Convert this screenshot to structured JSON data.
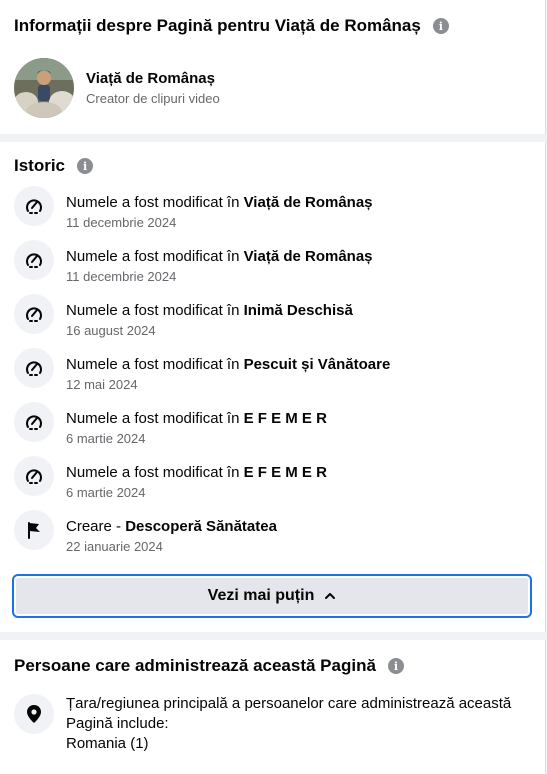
{
  "info": {
    "title": "Informații despre Pagină pentru Viață de Românaș",
    "page_name": "Viață de Românaș",
    "page_category": "Creator de clipuri video"
  },
  "history": {
    "title": "Istoric",
    "items": [
      {
        "prefix": "Numele a fost modificat în ",
        "name": "Viață de Românaș",
        "date": "11 decembrie 2024",
        "icon": "rename-icon"
      },
      {
        "prefix": "Numele a fost modificat în ",
        "name": "Viață de Românaș",
        "date": "11 decembrie 2024",
        "icon": "rename-icon"
      },
      {
        "prefix": "Numele a fost modificat în ",
        "name": "Inimă Deschisă",
        "date": "16 august 2024",
        "icon": "rename-icon"
      },
      {
        "prefix": "Numele a fost modificat în ",
        "name": "Pescuit și Vânătoare",
        "date": "12 mai 2024",
        "icon": "rename-icon"
      },
      {
        "prefix": "Numele a fost modificat în ",
        "name": "E F E M E R",
        "date": "6 martie 2024",
        "icon": "rename-icon"
      },
      {
        "prefix": "Numele a fost modificat în ",
        "name": "E F E M E R",
        "date": "6 martie 2024",
        "icon": "rename-icon"
      },
      {
        "prefix": "Creare - ",
        "name": "Descoperă Sănătatea",
        "date": "22 ianuarie 2024",
        "icon": "flag-icon"
      }
    ],
    "see_less_label": "Vezi mai puțin"
  },
  "admins": {
    "title": "Persoane care administrează această Pagină",
    "line1": "Țara/regiunea principală a persoanelor care administrează această Pagină include:",
    "line2": "Romania (1)"
  },
  "colors": {
    "accent": "#1b74e4",
    "text_secondary": "#65676b",
    "page_bg": "#f0f2f5"
  }
}
